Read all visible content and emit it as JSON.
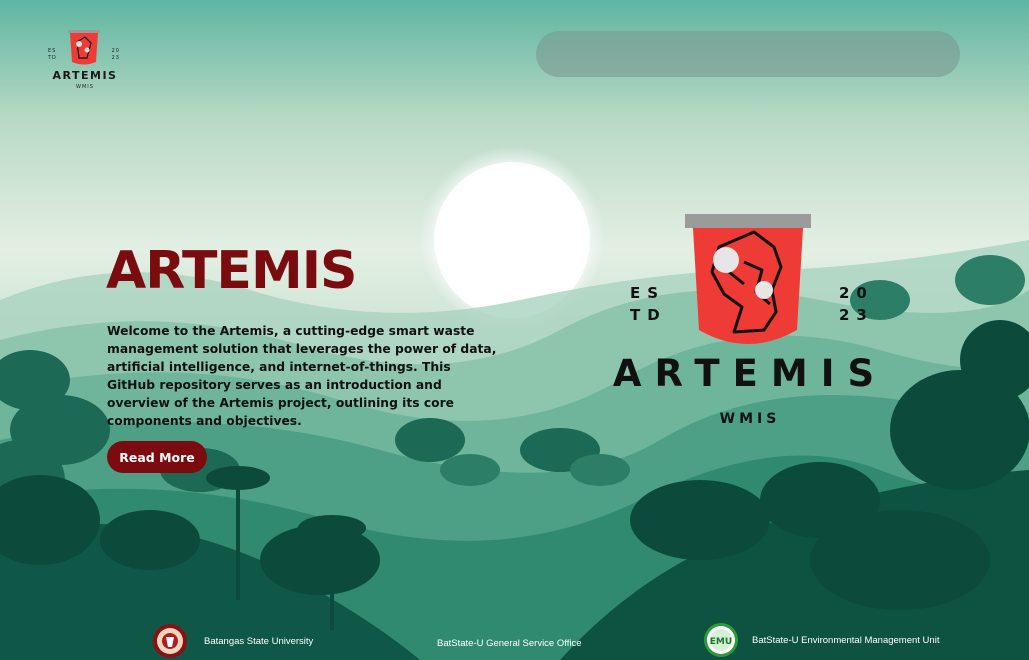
{
  "brand": {
    "small_logo": {
      "est_left": "ES TD",
      "est_right": "20 23",
      "name": "ARTEMIS",
      "sub": "WMIS"
    },
    "big_logo": {
      "est_left": "ES TD",
      "est_right": "20 23",
      "name": "ARTEMIS",
      "sub": "WMIS"
    }
  },
  "hero": {
    "title": "ARTEMIS",
    "description": "Welcome to the Artemis, a cutting-edge smart waste management solution that leverages the power of data, artificial intelligence, and internet-of-things. This GitHub repository serves as an introduction and overview of the Artemis project, outlining its core components and objectives.",
    "button_label": "Read More"
  },
  "footer": {
    "items": [
      {
        "label": "Batangas State University"
      },
      {
        "label": "BatState-U General Service Office"
      },
      {
        "label": "BatState-U Environmental Management Unit",
        "seal_text": "EMU"
      }
    ]
  },
  "colors": {
    "accent": "#7a0b0e",
    "bin_red": "#ef3b35",
    "forest_dark": "#0b4a3c",
    "sky": "#d9ebe0"
  }
}
